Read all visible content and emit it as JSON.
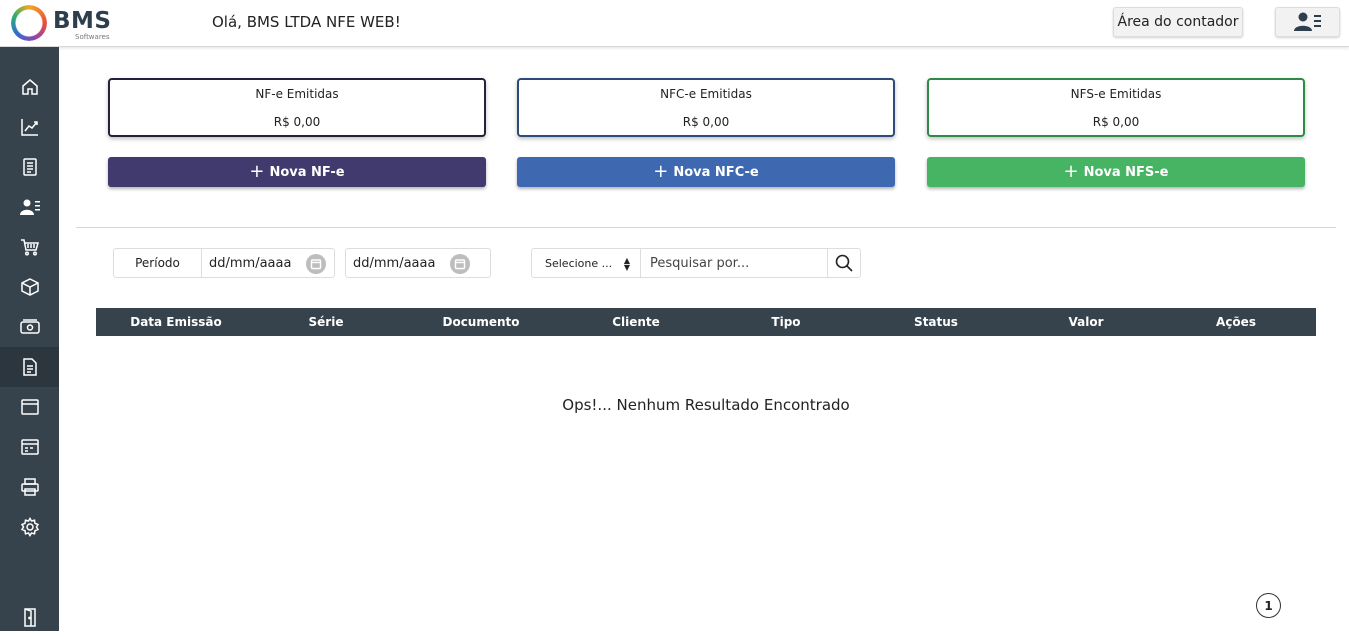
{
  "header": {
    "logo_text": "BMS",
    "logo_sub": "Softwares",
    "greeting": "Olá, BMS LTDA NFE WEB!",
    "contador_label": "Área do contador",
    "user_icon": "user-list-icon"
  },
  "sidebar": {
    "items": [
      {
        "icon": "home-icon"
      },
      {
        "icon": "chart-line-icon"
      },
      {
        "icon": "document-icon"
      },
      {
        "icon": "users-icon"
      },
      {
        "icon": "cart-icon"
      },
      {
        "icon": "box-icon"
      },
      {
        "icon": "money-icon"
      },
      {
        "icon": "invoice-icon",
        "active": true
      },
      {
        "icon": "window-icon"
      },
      {
        "icon": "calendar-card-icon"
      },
      {
        "icon": "printer-icon"
      },
      {
        "icon": "settings-icon"
      },
      {
        "icon": "logout-door-icon"
      }
    ]
  },
  "cards": [
    {
      "title": "NF-e Emitidas",
      "value": "R$ 0,00",
      "color": "#22223b"
    },
    {
      "title": "NFC-e Emitidas",
      "value": "R$ 0,00",
      "color": "#2d4a7a"
    },
    {
      "title": "NFS-e Emitidas",
      "value": "R$ 0,00",
      "color": "#2e8b45"
    }
  ],
  "actions": [
    {
      "label": "Nova NF-e",
      "color": "#413a6e"
    },
    {
      "label": "Nova NFC-e",
      "color": "#3e69b0"
    },
    {
      "label": "Nova NFS-e",
      "color": "#47b463"
    }
  ],
  "filters": {
    "periodo_label": "Período",
    "date_start_placeholder": "dd/mm/aaaa",
    "date_end_placeholder": "dd/mm/aaaa",
    "select_value": "Selecione ...",
    "search_placeholder": "Pesquisar por..."
  },
  "table": {
    "columns": [
      "Data Emissão",
      "Série",
      "Documento",
      "Cliente",
      "Tipo",
      "Status",
      "Valor",
      "Ações"
    ],
    "empty_message": "Ops!... Nenhum Resultado Encontrado"
  },
  "pagination": {
    "current_page": "1"
  }
}
